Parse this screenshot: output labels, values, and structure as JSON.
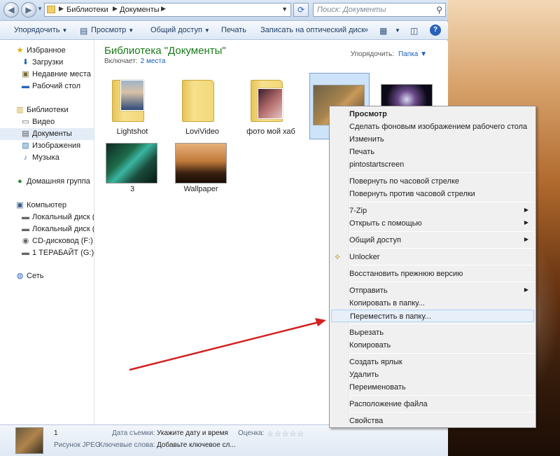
{
  "address": {
    "crumbs": [
      "Библиотеки",
      "Документы"
    ],
    "search_placeholder": "Поиск: Документы"
  },
  "toolbar": {
    "organize": "Упорядочить",
    "preview": "Просмотр",
    "share": "Общий доступ",
    "print": "Печать",
    "burn": "Записать на оптический диск",
    "more": "»"
  },
  "nav": {
    "favorites": "Избранное",
    "downloads": "Загрузки",
    "recent": "Недавние места",
    "desktop": "Рабочий стол",
    "libraries": "Библиотеки",
    "video": "Видео",
    "documents": "Документы",
    "images": "Изображения",
    "music": "Музыка",
    "homegroup": "Домашняя группа",
    "computer": "Компьютер",
    "disk_c": "Локальный диск (C",
    "disk_d": "Локальный диск (D",
    "cd": "CD-дисковод (F:)",
    "tb": "1 ТЕРАБАЙТ (G:)",
    "network": "Сеть"
  },
  "library": {
    "title": "Библиотека \"Документы\"",
    "includes_label": "Включает:",
    "includes_link": "2 места",
    "arrange_label": "Упорядочить:",
    "arrange_value": "Папка"
  },
  "files": [
    {
      "name": "Lightshot"
    },
    {
      "name": "LoviVideo"
    },
    {
      "name": "фото мой хаб"
    },
    {
      "name": ""
    },
    {
      "name": ""
    },
    {
      "name": "3"
    },
    {
      "name": "Wallpaper"
    }
  ],
  "details": {
    "name": "1",
    "type": "Рисунок JPEG",
    "date_label": "Дата съемки:",
    "date_value": "Укажите дату и время",
    "keywords_label": "Ключевые слова:",
    "keywords_value": "Добавьте ключевое сл...",
    "rating_label": "Оценка:",
    "rating": 0
  },
  "context_menu": {
    "preview": "Просмотр",
    "set_wallpaper": "Сделать фоновым изображением рабочего стола",
    "edit": "Изменить",
    "print": "Печать",
    "pintostart": "pintostartscreen",
    "rotate_cw": "Повернуть по часовой стрелке",
    "rotate_ccw": "Повернуть против часовой стрелки",
    "sevenzip": "7-Zip",
    "open_with": "Открыть с помощью",
    "share": "Общий доступ",
    "unlocker": "Unlocker",
    "restore": "Восстановить прежнюю версию",
    "send_to": "Отправить",
    "copy_to": "Копировать в папку...",
    "move_to": "Переместить в папку...",
    "cut": "Вырезать",
    "copy": "Копировать",
    "shortcut": "Создать ярлык",
    "delete": "Удалить",
    "rename": "Переименовать",
    "location": "Расположение файла",
    "properties": "Свойства"
  },
  "colors": {
    "annotation_arrow": "#d42020",
    "library_title": "#1a7a1a",
    "link": "#1a5fb4",
    "menu_highlight": "#e8eff8"
  }
}
